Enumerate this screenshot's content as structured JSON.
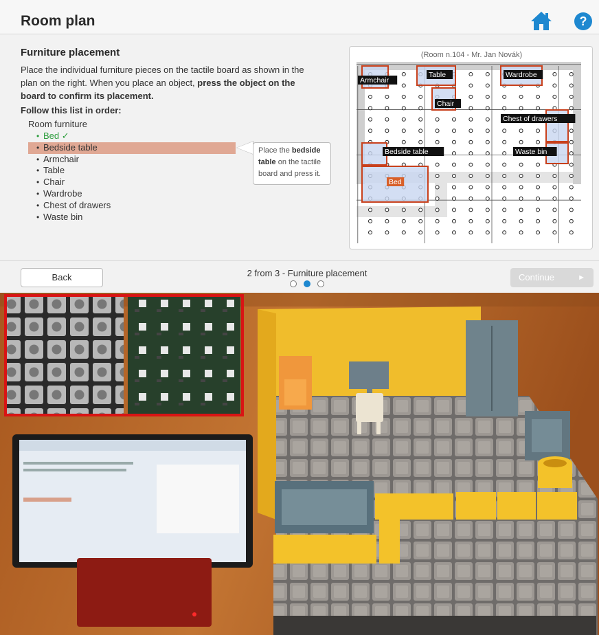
{
  "header": {
    "title": "Room plan",
    "home_icon": "home-icon",
    "help_icon": "help-icon",
    "help_symbol": "?",
    "accent_color": "#1e88d0"
  },
  "section": {
    "title": "Furniture placement",
    "instructions_part1": "Place the individual furniture pieces on the tactile board as shown in the plan on the right. When you place an object, ",
    "instructions_bold": "press the object on the board to confirm its placement."
  },
  "list": {
    "heading": "Follow this list in order:",
    "group": "Room furniture",
    "items": [
      {
        "label": "Bed ✓",
        "state": "done"
      },
      {
        "label": "Bedside table",
        "state": "active"
      },
      {
        "label": "Armchair",
        "state": "pending"
      },
      {
        "label": "Table",
        "state": "pending"
      },
      {
        "label": "Chair",
        "state": "pending"
      },
      {
        "label": "Wardrobe",
        "state": "pending"
      },
      {
        "label": "Chest of drawers",
        "state": "pending"
      },
      {
        "label": "Waste bin",
        "state": "pending"
      }
    ],
    "bullet": "•"
  },
  "tooltip": {
    "prefix": "Place the ",
    "bold": "bedside table",
    "suffix": " on the tactile board and press it."
  },
  "plan": {
    "caption": "(Room n.104 - Mr. Jan Novák)",
    "labels": {
      "armchair": "Armchair",
      "table": "Table",
      "wardrobe": "Wardrobe",
      "chair": "Chair",
      "chest": "Chest of drawers",
      "bedside": "Bedside table",
      "waste": "Waste bin",
      "bed": "Bed"
    }
  },
  "nav": {
    "back_label": "Back",
    "step_label": "2 from 3 - Furniture placement",
    "continue_label": "Continue",
    "continue_arrow": "►",
    "steps_total": 3,
    "current_step": 2
  }
}
